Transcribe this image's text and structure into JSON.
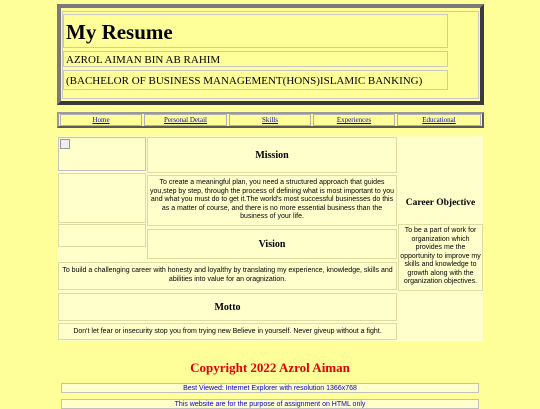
{
  "header": {
    "title": "My Resume",
    "name": "AZROL AIMAN BIN AB RAHIM",
    "degree": "(BACHELOR OF BUSINESS MANAGEMENT(HONS)ISLAMIC BANKING)"
  },
  "nav": [
    {
      "label": "Home"
    },
    {
      "label": "Personal Detail"
    },
    {
      "label": "Skills"
    },
    {
      "label": "Experiences"
    },
    {
      "label": "Educational"
    }
  ],
  "mission": {
    "title": "Mission",
    "text": "To create a meaningful plan, you need a structured approach that guides you,step by step, through the process of defining what is most important to you and what you must do to get it.The world's most successful businesses do this as a matter of course, and there is no more essential business than the business of your life."
  },
  "vision": {
    "title": "Vision",
    "text": "To build a challenging career with honesty and loyalthy by translating my experience, knowledge, skills and abilities into value for an oragnization."
  },
  "motto": {
    "title": "Motto",
    "text": "Don't let fear or insecurity stop you from trying new Believe in yourself. Never giveup without a fight."
  },
  "career": {
    "title": "Career Objective",
    "text": "To be a part of work for organization which provides me the opportunity to improve my skills and knowledge to growth along with the organization objectives."
  },
  "footer": {
    "copyright": "Copyright 2022 Azrol Aiman",
    "best_viewed": "Best Viewed: Internet Explorer with resolution 1366x768",
    "purpose": "This website are for the purpose of assignment on HTML only"
  },
  "colors": {
    "page_background": "#ffff99",
    "content_background": "#ffffcc",
    "link": "#0000cc",
    "copyright": "#e00000"
  },
  "icons": {
    "profile_image": "broken-image-icon"
  }
}
